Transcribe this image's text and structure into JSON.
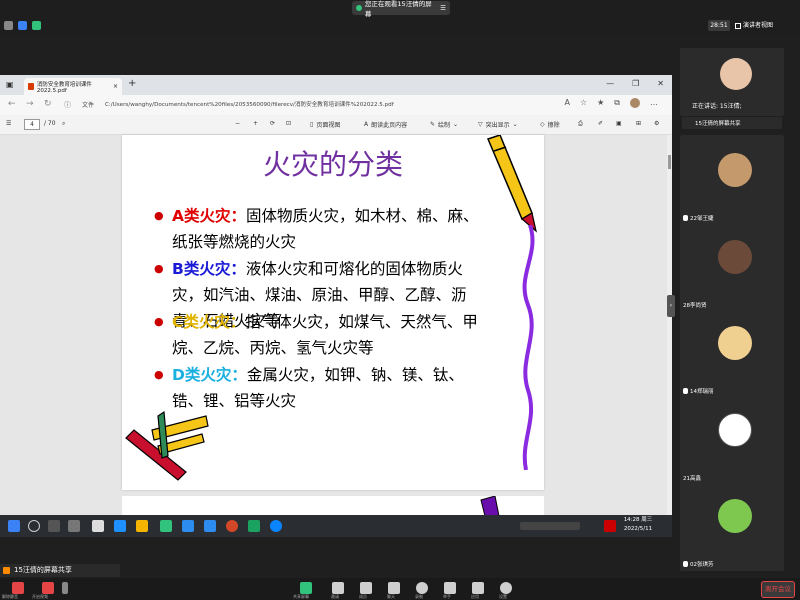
{
  "meeting": {
    "share_notice": "您正在观看15汪倩的屏幕",
    "timer": "28:51",
    "view_mode": "演讲者视图",
    "speaking_label": "正在讲话: 15汪倩;",
    "share_badge": "15汪倩的屏幕共享",
    "leave_button": "离开会议"
  },
  "browser": {
    "tab_title": "消防安全教育培训课件 2022.5.pdf",
    "file_label": "文件",
    "url": "C:/Users/wanghy/Documents/tencent%20files/2053560090/filerecv/消防安全教育培训课件%202022.5.pdf",
    "page_current": "4",
    "page_total": "/ 70",
    "toolbar": {
      "minus": "−",
      "plus": "+",
      "page_view": "页面视图",
      "read_aloud": "朗读此页内容",
      "draw": "绘制",
      "highlight": "突出显示",
      "erase": "擦除"
    }
  },
  "slide": {
    "title": "火灾的分类",
    "items": [
      {
        "head": "A类火灾：",
        "body": "固体物质火灾，如木材、棉、麻、纸张等燃烧的火灾",
        "color": "#e00000"
      },
      {
        "head": "B类火灾：",
        "body": "液体火灾和可熔化的固体物质火灾，如汽油、煤油、原油、甲醇、乙醇、沥青、石蜡火灾等",
        "color": "#1a1ad6"
      },
      {
        "head": "C类火灾：",
        "body": "指气体火灾，如煤气、天然气、甲烷、乙烷、丙烷、氢气火灾等",
        "color": "#e0b400"
      },
      {
        "head": "D类火灾：",
        "body": "金属火灾，如钾、钠、镁、钛、锆、锂、铝等火灾",
        "color": "#1ab0e0"
      }
    ]
  },
  "taskbar": {
    "time": "14:28 周三",
    "date": "2022/5/11"
  },
  "participants": [
    {
      "name": "15汪倩的屏幕共享"
    },
    {
      "name": "22邹王婕"
    },
    {
      "name": "28李尚贤"
    },
    {
      "name": "14郑瑞丽"
    },
    {
      "name": "21高鑫"
    },
    {
      "name": "02张琪芳"
    }
  ],
  "controls": [
    "解除静音",
    "开启视频",
    "共享屏幕",
    "邀请",
    "成员",
    "聊天",
    "录制",
    "举手",
    "应用",
    "设置"
  ]
}
